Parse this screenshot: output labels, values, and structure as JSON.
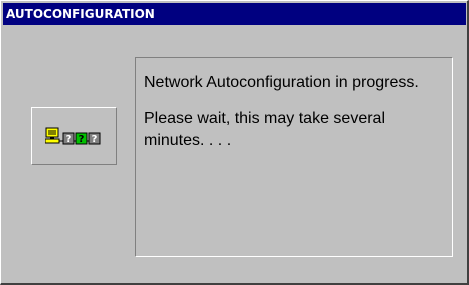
{
  "window": {
    "title": "AUTOCONFIGURATION"
  },
  "status_icon": {
    "name": "network-autoconfig-icon",
    "colors": {
      "computer": "#ffff00",
      "unknown": "#808080",
      "active": "#00c000"
    }
  },
  "message": {
    "line1": "Network Autoconfiguration in progress.",
    "line2": "Please wait, this may take several minutes. . . ."
  }
}
